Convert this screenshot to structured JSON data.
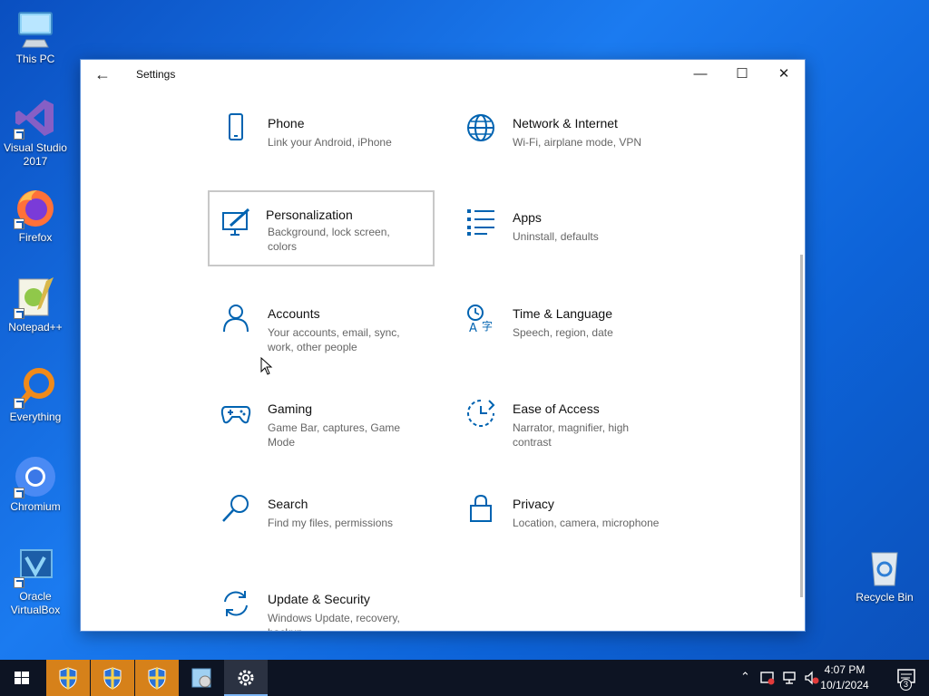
{
  "desktop": {
    "icons": [
      {
        "label": "This PC"
      },
      {
        "label": "Visual Studio 2017"
      },
      {
        "label": "Firefox"
      },
      {
        "label": "Notepad++"
      },
      {
        "label": "Everything"
      },
      {
        "label": "Chromium"
      },
      {
        "label": "Oracle VirtualBox"
      },
      {
        "label": "Recycle Bin"
      }
    ]
  },
  "window": {
    "title": "Settings",
    "back_icon": "back-arrow-icon"
  },
  "settings": [
    {
      "name": "Phone",
      "desc": "Link your Android, iPhone",
      "icon": "phone-icon"
    },
    {
      "name": "Network & Internet",
      "desc": "Wi-Fi, airplane mode, VPN",
      "icon": "globe-icon"
    },
    {
      "name": "Personalization",
      "desc": "Background, lock screen, colors",
      "icon": "personalization-icon"
    },
    {
      "name": "Apps",
      "desc": "Uninstall, defaults",
      "icon": "apps-list-icon"
    },
    {
      "name": "Accounts",
      "desc": "Your accounts, email, sync, work, other people",
      "icon": "person-icon"
    },
    {
      "name": "Time & Language",
      "desc": "Speech, region, date",
      "icon": "time-language-icon"
    },
    {
      "name": "Gaming",
      "desc": "Game Bar, captures, Game Mode",
      "icon": "gamepad-icon"
    },
    {
      "name": "Ease of Access",
      "desc": "Narrator, magnifier, high contrast",
      "icon": "ease-of-access-icon"
    },
    {
      "name": "Search",
      "desc": "Find my files, permissions",
      "icon": "search-icon"
    },
    {
      "name": "Privacy",
      "desc": "Location, camera, microphone",
      "icon": "lock-icon"
    },
    {
      "name": "Update & Security",
      "desc": "Windows Update, recovery, backup",
      "icon": "update-icon"
    }
  ],
  "taskbar": {
    "time": "4:07 PM",
    "date": "10/1/2024",
    "notification_count": "3"
  },
  "colors": {
    "accent": "#0063b1",
    "taskbar": "#0d1423",
    "uac_button": "#d6811a"
  }
}
